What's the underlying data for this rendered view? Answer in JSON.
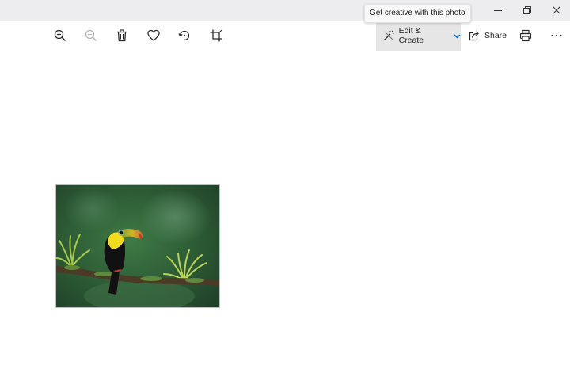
{
  "titlebar": {
    "tooltip": "Get creative with this photo",
    "minimize_icon": "minimize-icon",
    "restore_icon": "restore-icon",
    "close_icon": "close-icon"
  },
  "toolbar": {
    "icons": [
      "zoom-in-icon",
      "zoom-out-icon",
      "delete-icon",
      "favorite-heart-icon",
      "rotate-icon",
      "crop-icon",
      "print-icon",
      "more-icon"
    ],
    "edit_create_label": "Edit & Create",
    "share_label": "Share",
    "accent": "#0067c0"
  },
  "photo": {
    "subject": "toucan-on-branch"
  }
}
